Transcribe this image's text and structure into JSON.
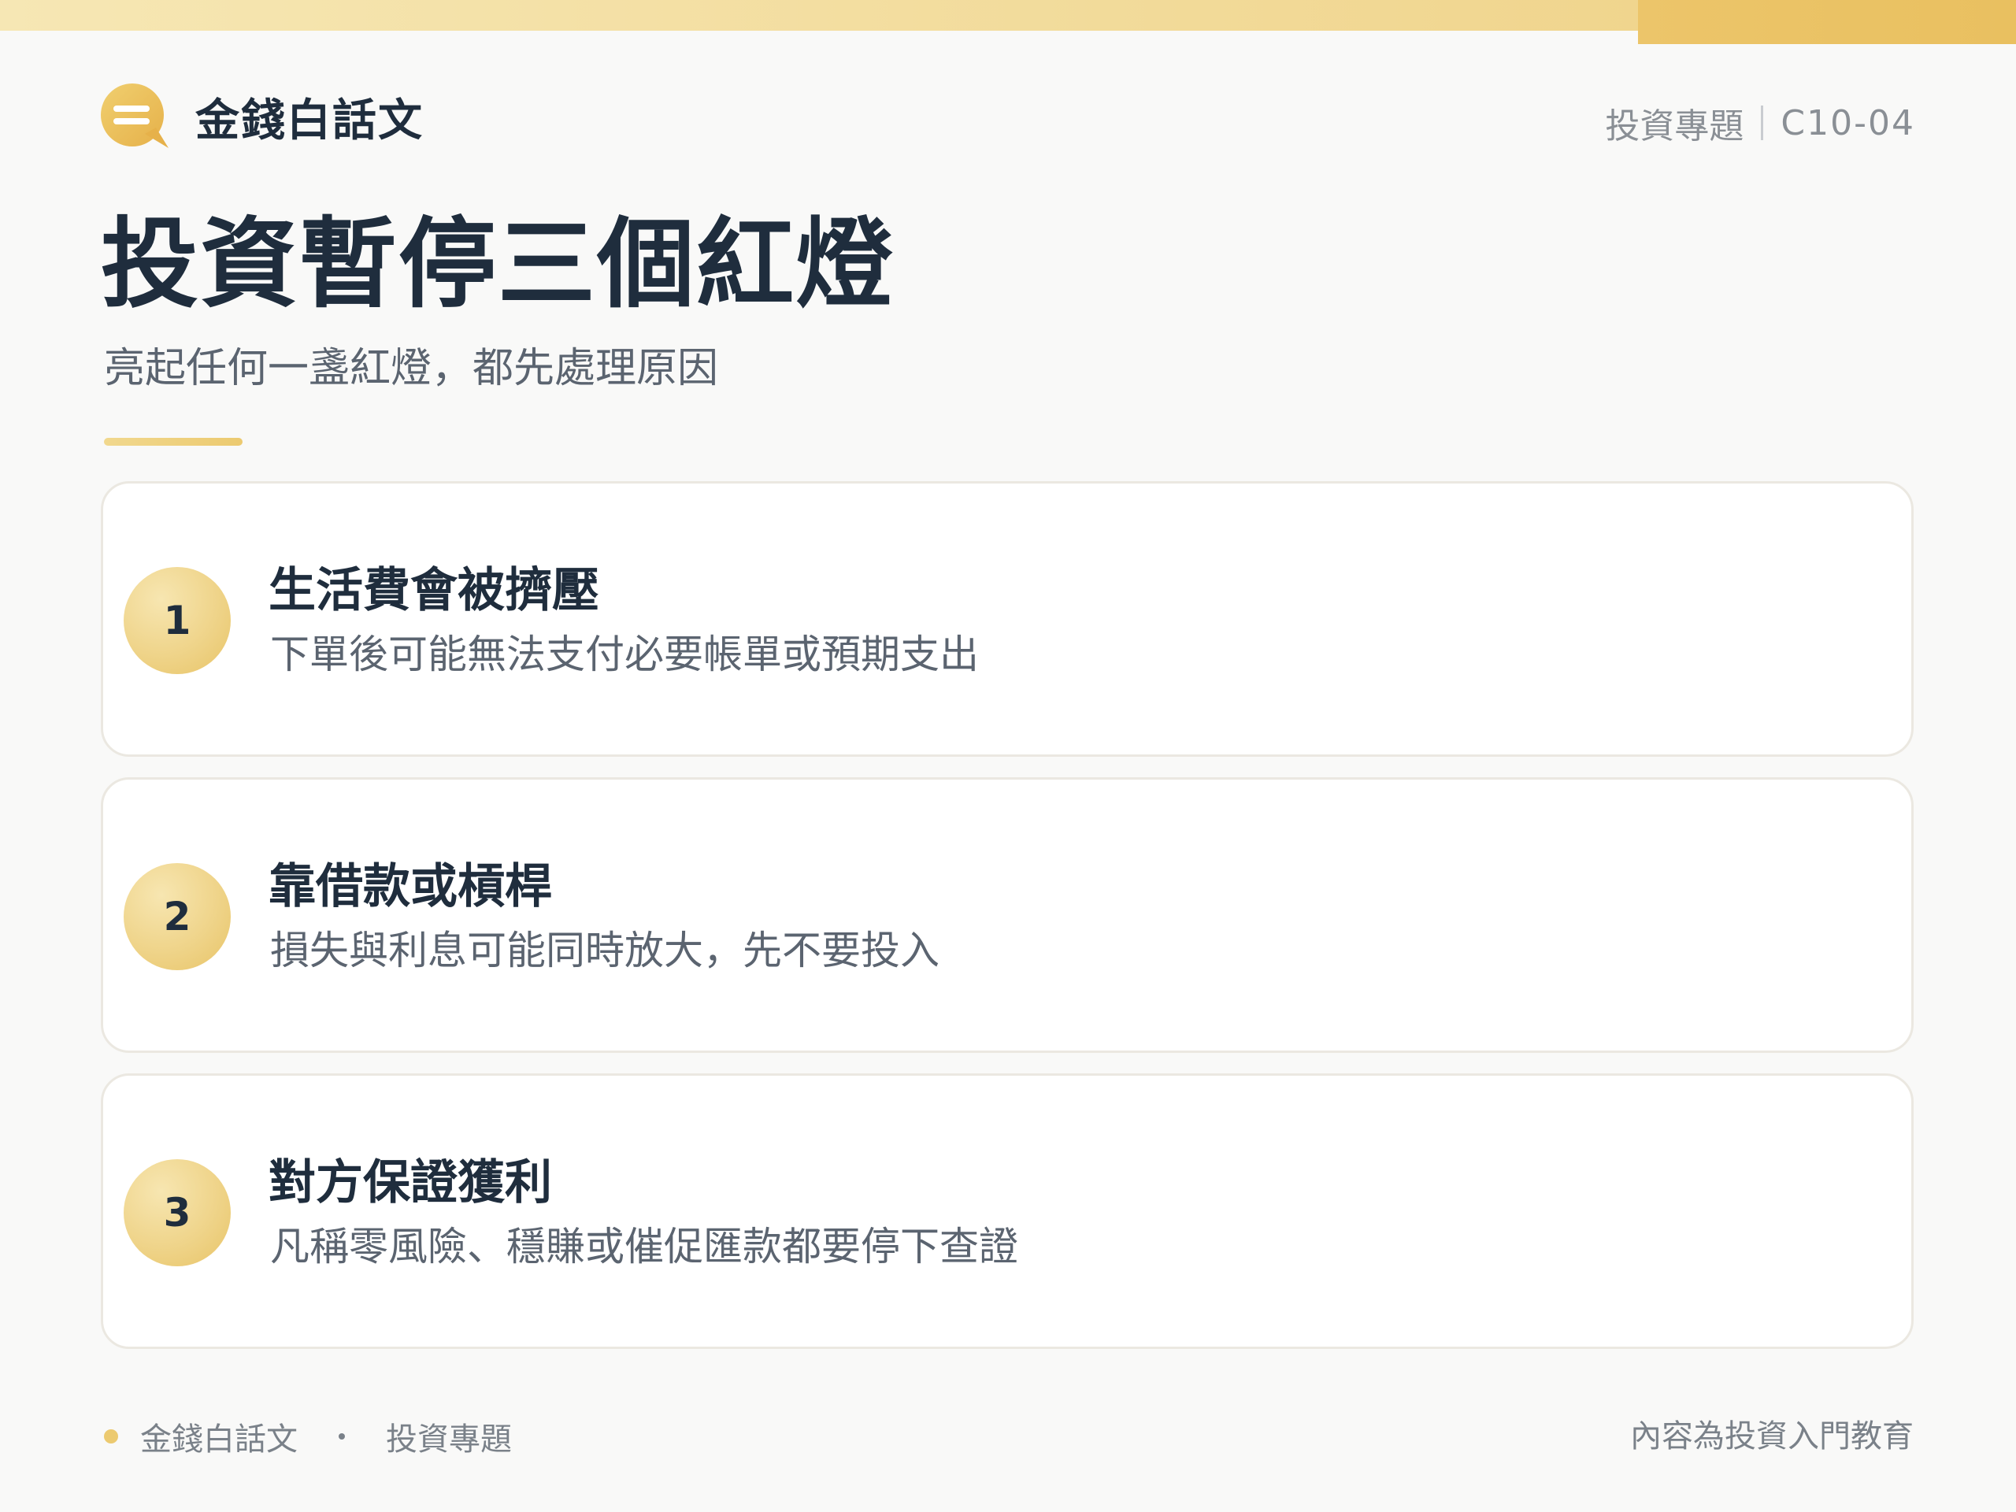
{
  "brand": {
    "name": "金錢白話文",
    "icon": "chat-bubble-icon"
  },
  "topic": {
    "category": "投資專題",
    "code": "C10-04"
  },
  "title": "投資暫停三個紅燈",
  "subtitle": "亮起任何一盞紅燈，都先處理原因",
  "items": [
    {
      "number": "1",
      "title": "生活費會被擠壓",
      "description": "下單後可能無法支付必要帳單或預期支出"
    },
    {
      "number": "2",
      "title": "靠借款或槓桿",
      "description": "損失與利息可能同時放大，先不要投入"
    },
    {
      "number": "3",
      "title": "對方保證獲利",
      "description": "凡稱零風險、穩賺或催促匯款都要停下查證"
    }
  ],
  "footer": {
    "brand": "金錢白話文",
    "category": "投資專題",
    "disclaimer": "內容為投資入門教育"
  },
  "colors": {
    "accent": "#ecca70",
    "accent_light": "#f6e7b4",
    "text_primary": "#1f2d3d",
    "text_secondary": "#5b6470",
    "background": "#f9f9f8"
  }
}
